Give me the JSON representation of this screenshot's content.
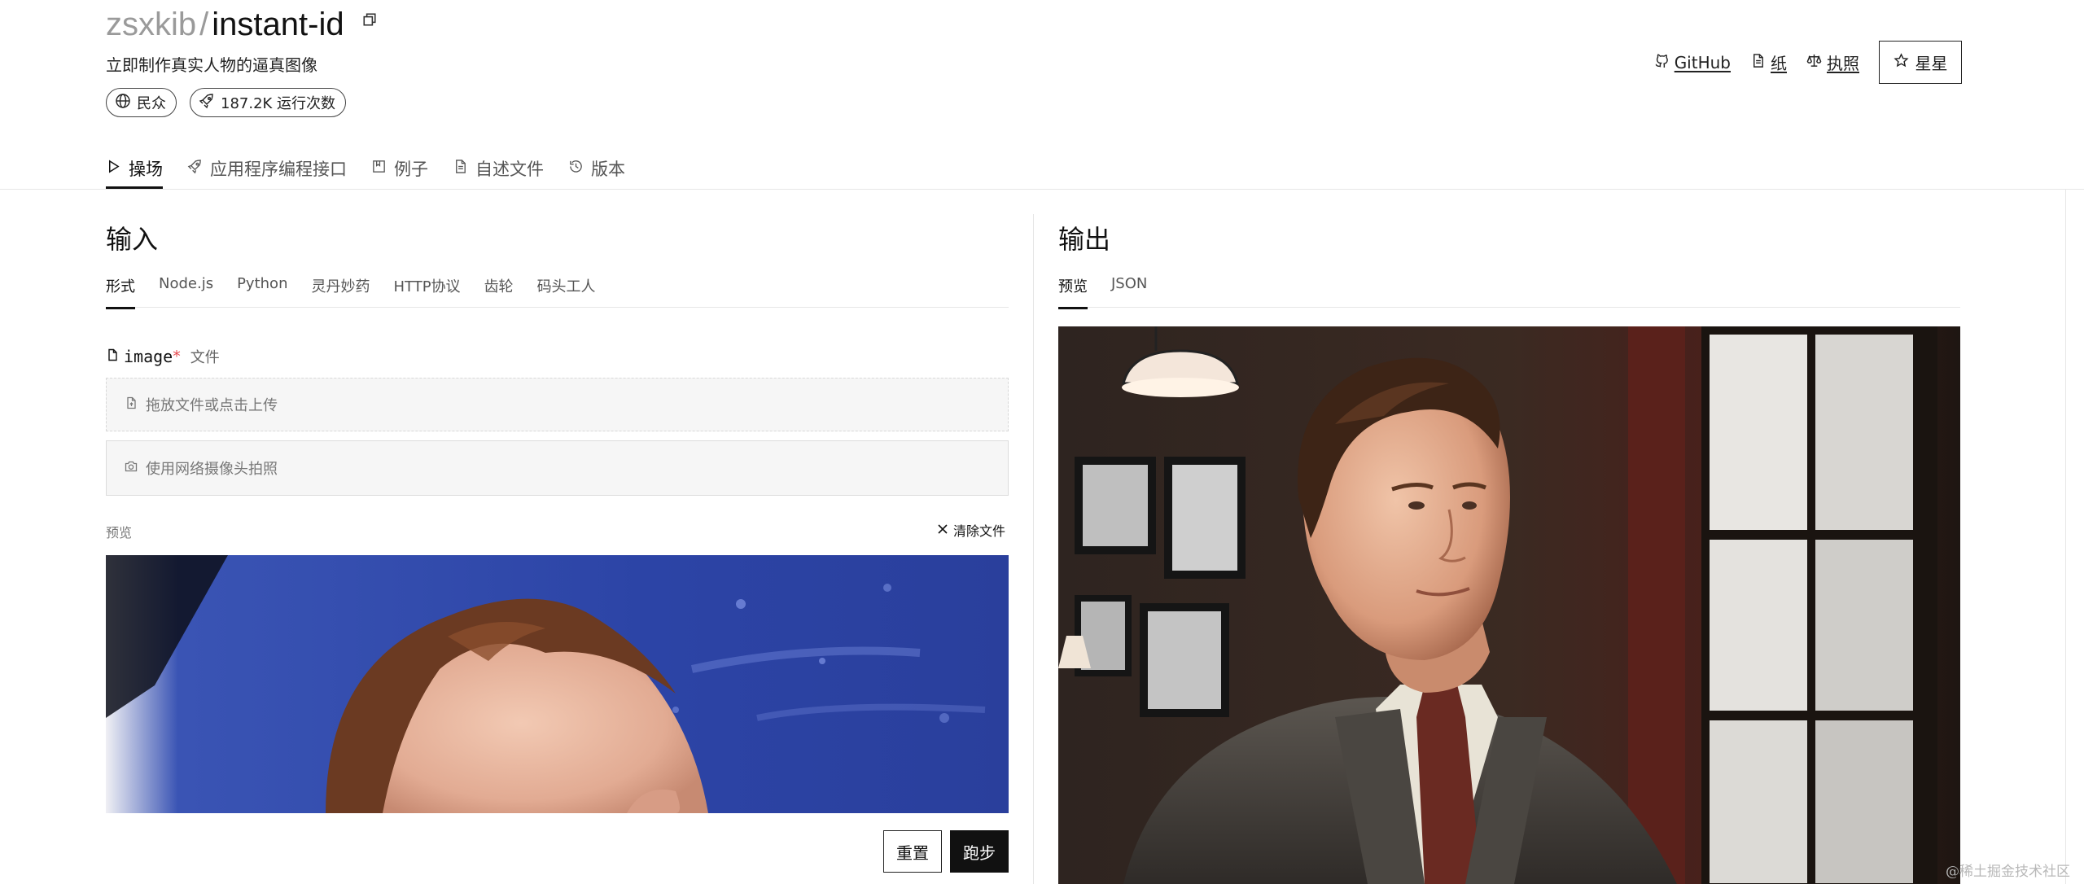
{
  "header": {
    "owner": "zsxkib",
    "separator": "/",
    "model": "instant-id",
    "description": "立即制作真实人物的逼真图像",
    "pills": [
      {
        "icon": "globe-icon",
        "label": "民众"
      },
      {
        "icon": "rocket-icon",
        "label": "187.2K 运行次数"
      }
    ],
    "links": [
      {
        "icon": "github-icon",
        "label": "GitHub"
      },
      {
        "icon": "document-icon",
        "label": "纸"
      },
      {
        "icon": "scale-icon",
        "label": "执照"
      }
    ],
    "star_label": "星星"
  },
  "tabs": [
    {
      "icon": "play-icon",
      "label": "操场",
      "active": true
    },
    {
      "icon": "rocket-icon",
      "label": "应用程序编程接口",
      "active": false
    },
    {
      "icon": "bookmark-icon",
      "label": "例子",
      "active": false
    },
    {
      "icon": "document-icon",
      "label": "自述文件",
      "active": false
    },
    {
      "icon": "history-icon",
      "label": "版本",
      "active": false
    }
  ],
  "input": {
    "title": "输入",
    "subtabs": [
      "形式",
      "Node.js",
      "Python",
      "灵丹妙药",
      "HTTP协议",
      "齿轮",
      "码头工人"
    ],
    "active_subtab": "形式",
    "field": {
      "name": "image",
      "required_mark": "*",
      "type": "文件"
    },
    "dropzone_label": "拖放文件或点击上传",
    "webcam_label": "使用网络摄像头拍照",
    "preview_label": "预览",
    "clear_label": "清除文件",
    "reset_label": "重置",
    "run_label": "跑步"
  },
  "output": {
    "title": "输出",
    "subtabs": [
      "预览",
      "JSON"
    ],
    "active_subtab": "预览"
  },
  "watermark": "@稀土掘金技术社区",
  "colors": {
    "text": "#111111",
    "muted": "#777777",
    "required": "#e5484d",
    "run_button": "#111111"
  }
}
